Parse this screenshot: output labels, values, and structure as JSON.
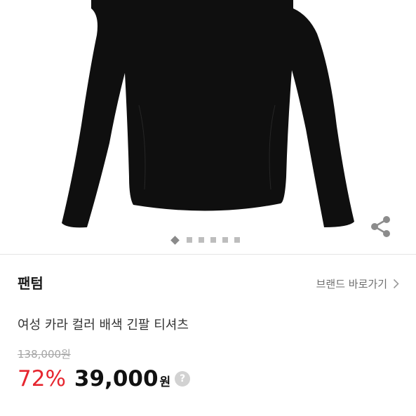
{
  "product": {
    "brand": "팬텀",
    "brand_link_label": "브랜드 바로가기",
    "title": "여성 카라 컬러 배색 긴팔 티셔츠",
    "original_price": "138,000원",
    "discount": "72%",
    "sale_price": "39,000",
    "currency": "원",
    "help_glyph": "?"
  },
  "gallery": {
    "total_slides": 6,
    "active_slide": 1
  },
  "colors": {
    "discount_red": "#e6262f",
    "text_dark": "#111111",
    "garment": "#0f0f0f"
  },
  "icons": {
    "share": "share-icon",
    "chevron": "chevron-right-icon",
    "help": "question-mark-icon"
  }
}
